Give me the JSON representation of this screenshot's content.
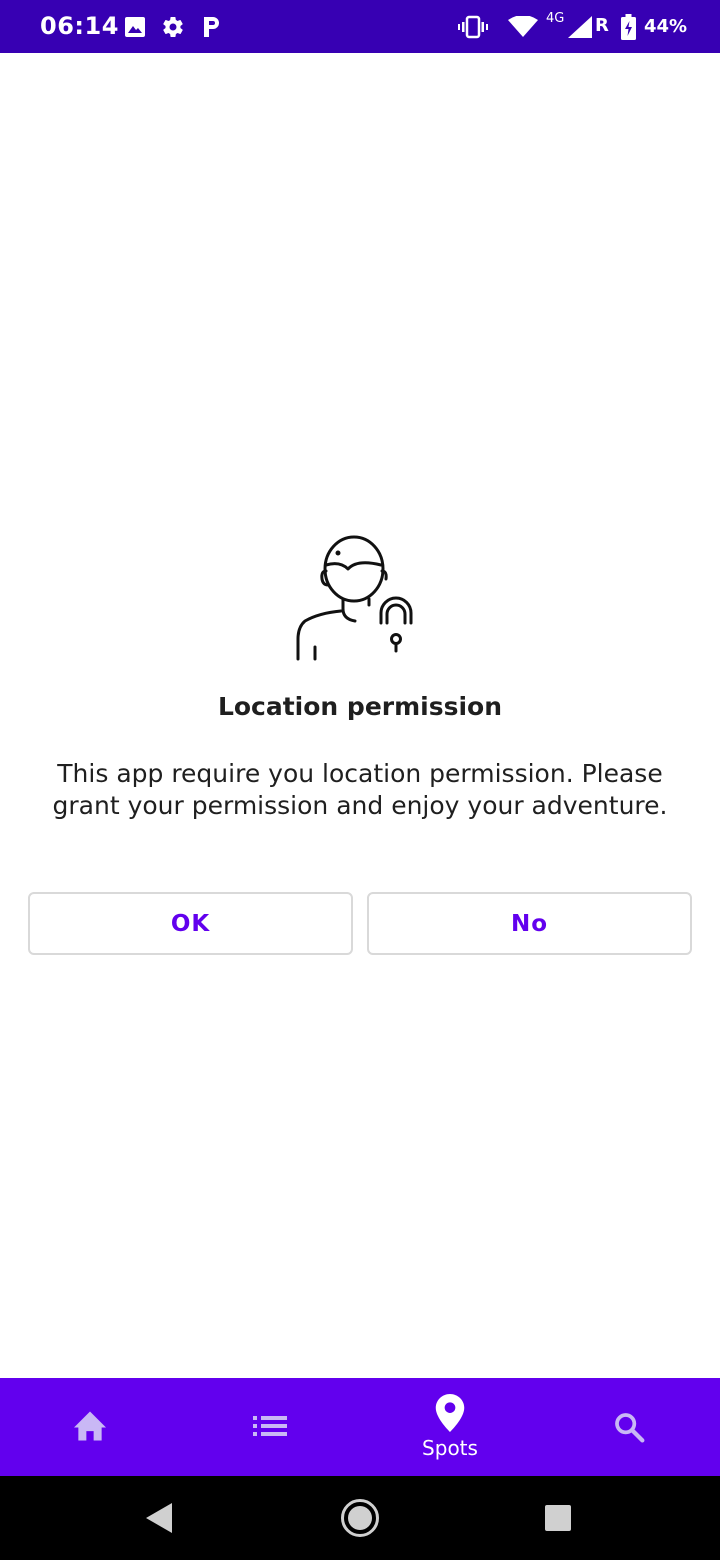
{
  "status_bar": {
    "time": "06:14",
    "network_type": "4G",
    "roaming": "R",
    "battery": "44%",
    "icons": [
      "image-icon",
      "gear-icon",
      "parking-icon",
      "vibrate-icon",
      "wifi-icon",
      "signal-icon",
      "battery-icon"
    ]
  },
  "dialog": {
    "icon": "user-lock-icon",
    "title": "Location permission",
    "message": "This app require you location permission. Please grant your permission and enjoy your adventure.",
    "ok_label": "OK",
    "no_label": "No"
  },
  "bottom_nav": {
    "items": [
      {
        "icon": "home-icon",
        "label": ""
      },
      {
        "icon": "list-icon",
        "label": ""
      },
      {
        "icon": "location-pin-icon",
        "label": "Spots"
      },
      {
        "icon": "search-icon",
        "label": ""
      }
    ],
    "selected_index": 2
  },
  "colors": {
    "status_bar": "#3700B3",
    "primary": "#6200EE",
    "nav_inactive": "#C9B8F5",
    "text": "#1f1f1f"
  }
}
